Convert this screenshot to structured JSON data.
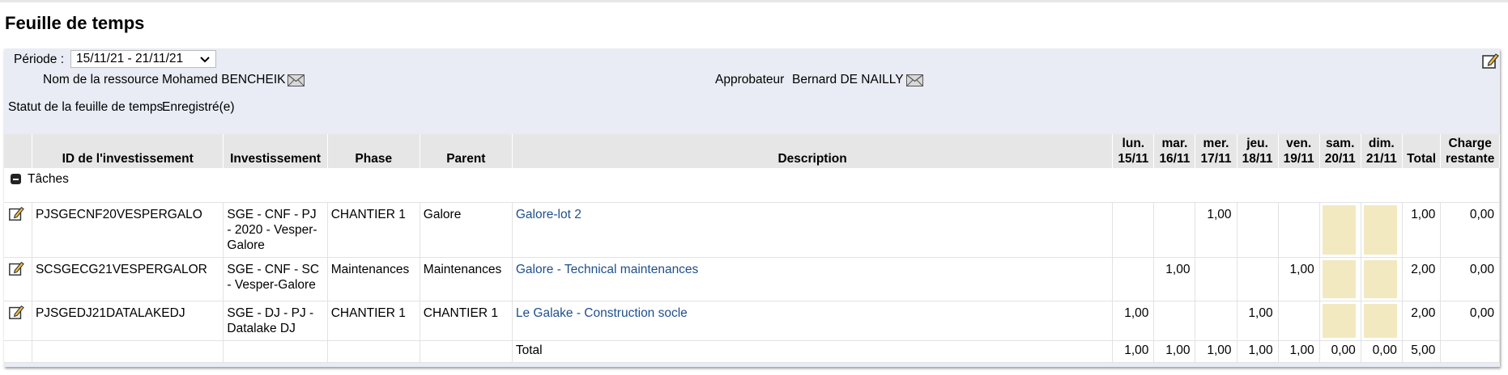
{
  "page": {
    "title": "Feuille de temps"
  },
  "header": {
    "period_label": "Période :",
    "period_value": "15/11/21 - 21/11/21",
    "resource_label": "Nom de la ressource",
    "resource_value": "Mohamed BENCHEIK",
    "approver_label": "Approbateur",
    "approver_value": "Bernard DE NAILLY",
    "status_label": "Statut de la feuille de temps",
    "status_value": "Enregistré(e)"
  },
  "table": {
    "columns": {
      "id": "ID de l'investissement",
      "investment": "Investissement",
      "phase": "Phase",
      "parent": "Parent",
      "description": "Description",
      "total": "Total",
      "remaining": "Charge restante"
    },
    "days": [
      {
        "day": "lun.",
        "date": "15/11"
      },
      {
        "day": "mar.",
        "date": "16/11"
      },
      {
        "day": "mer.",
        "date": "17/11"
      },
      {
        "day": "jeu.",
        "date": "18/11"
      },
      {
        "day": "ven.",
        "date": "19/11"
      },
      {
        "day": "sam.",
        "date": "20/11"
      },
      {
        "day": "dim.",
        "date": "21/11"
      }
    ],
    "section_label": "Tâches",
    "rows": [
      {
        "id": "PJSGECNF20VESPERGALO",
        "investment": "SGE - CNF - PJ - 2020 - Vesper-Galore",
        "phase": "CHANTIER 1",
        "parent": "Galore",
        "description": "Galore-lot 2",
        "hours": [
          "",
          "",
          "1,00",
          "",
          "",
          "",
          ""
        ],
        "total": "1,00",
        "remaining": "0,00"
      },
      {
        "id": "SCSGECG21VESPERGALOR",
        "investment": "SGE - CNF - SC - Vesper-Galore",
        "phase": "Maintenances",
        "parent": "Maintenances",
        "description": "Galore - Technical maintenances",
        "hours": [
          "",
          "1,00",
          "",
          "",
          "1,00",
          "",
          ""
        ],
        "total": "2,00",
        "remaining": "0,00"
      },
      {
        "id": "PJSGEDJ21DATALAKEDJ",
        "investment": "SGE - DJ - PJ - Datalake DJ",
        "phase": "CHANTIER 1",
        "parent": "CHANTIER 1",
        "description": "Le Galake - Construction socle",
        "hours": [
          "1,00",
          "",
          "",
          "1,00",
          "",
          "",
          ""
        ],
        "total": "2,00",
        "remaining": "0,00"
      }
    ],
    "totals": {
      "label": "Total",
      "days": [
        "1,00",
        "1,00",
        "1,00",
        "1,00",
        "1,00",
        "0,00",
        "0,00"
      ],
      "total": "5,00"
    }
  },
  "colors": {
    "panel_bg": "#e9ecf5",
    "header_bg": "#e6e6e6",
    "weekend_fill": "#f2e9c1",
    "link": "#1e4f8d"
  },
  "icons": [
    "chevron-down-icon",
    "edit-icon",
    "mail-icon",
    "collapse-icon"
  ]
}
